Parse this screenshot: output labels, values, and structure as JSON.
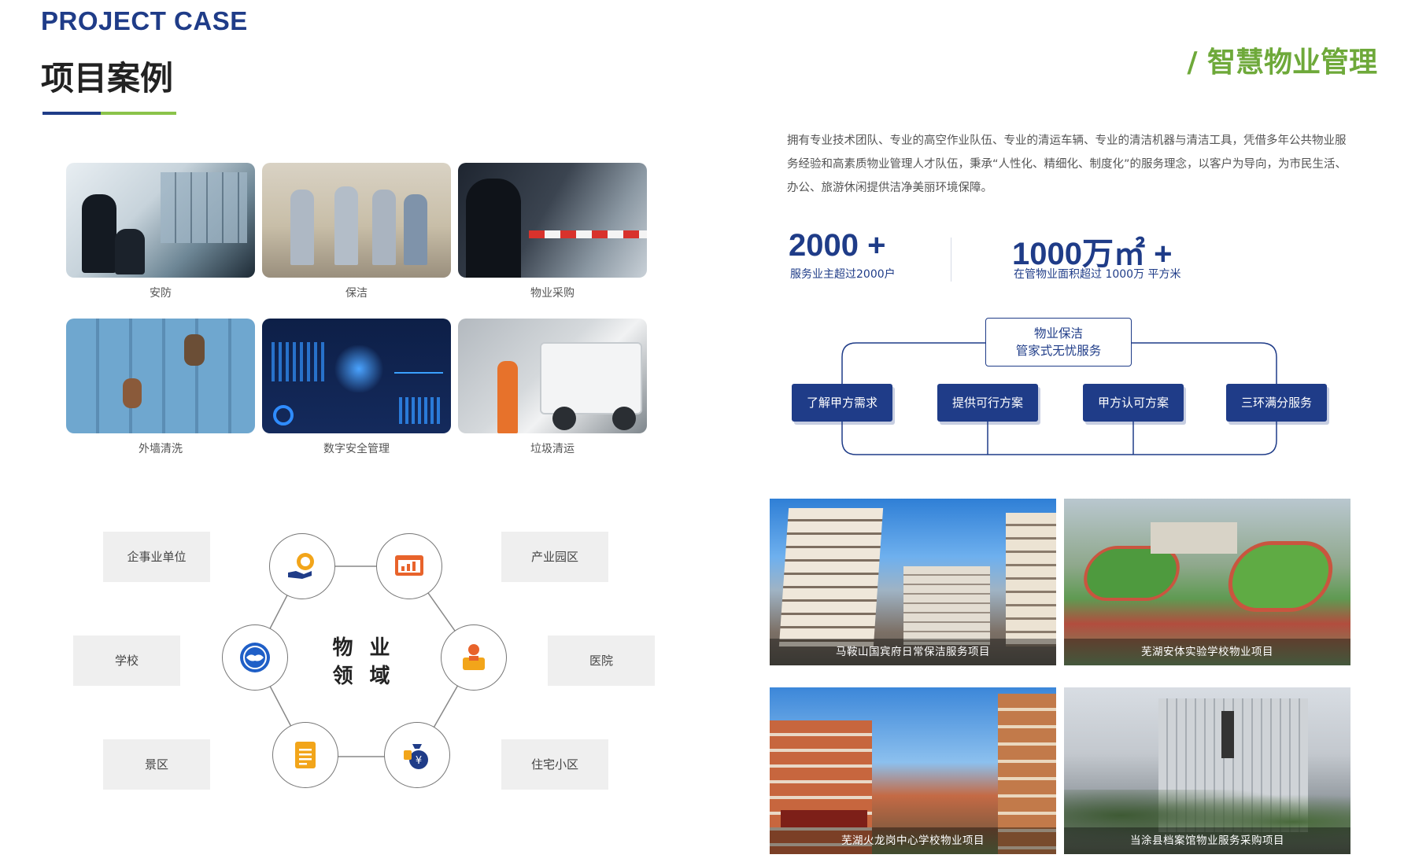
{
  "header": {
    "en_title": "PROJECT CASE",
    "cn_title": "项目案例",
    "section_tag": "/ 智慧物业管理"
  },
  "services": [
    {
      "label": "安防"
    },
    {
      "label": "保洁"
    },
    {
      "label": "物业采购"
    },
    {
      "label": "外墙清洗"
    },
    {
      "label": "数字安全管理"
    },
    {
      "label": "垃圾清运"
    }
  ],
  "intro": {
    "text": "拥有专业技术团队、专业的高空作业队伍、专业的清运车辆、专业的清洁机器与清洁工具，凭借多年公共物业服务经验和高素质物业管理人才队伍，秉承“人性化、精细化、制度化”的服务理念，以客户为导向，为市民生活、办公、旅游休闲提供洁净美丽环境保障。"
  },
  "stats": [
    {
      "value": "2000 +",
      "desc": "服务业主超过2000户"
    },
    {
      "value": "1000万㎡ +",
      "desc": "在管物业面积超过 1000万 平方米"
    }
  ],
  "flow": {
    "top_line1": "物业保洁",
    "top_line2": "管家式无忧服务",
    "steps": [
      "了解甲方需求",
      "提供可行方案",
      "甲方认可方案",
      "三环满分服务"
    ]
  },
  "domain": {
    "center_line1": "物 业",
    "center_line2": "领 域",
    "categories": [
      "企事业单位",
      "产业园区",
      "学校",
      "医院",
      "景区",
      "住宅小区"
    ],
    "node_icons": [
      "hand-coin-icon",
      "monitor-chart-icon",
      "handshake-icon",
      "worker-icon",
      "document-icon",
      "money-bag-icon"
    ]
  },
  "projects": [
    {
      "caption": "马鞍山国宾府日常保洁服务项目"
    },
    {
      "caption": "芜湖安体实验学校物业项目"
    },
    {
      "caption": "芜湖火龙岗中心学校物业项目"
    },
    {
      "caption": "当涂县档案馆物业服务采购项目"
    }
  ],
  "colors": {
    "primary": "#1f3c88",
    "accent": "#6ea93a"
  }
}
